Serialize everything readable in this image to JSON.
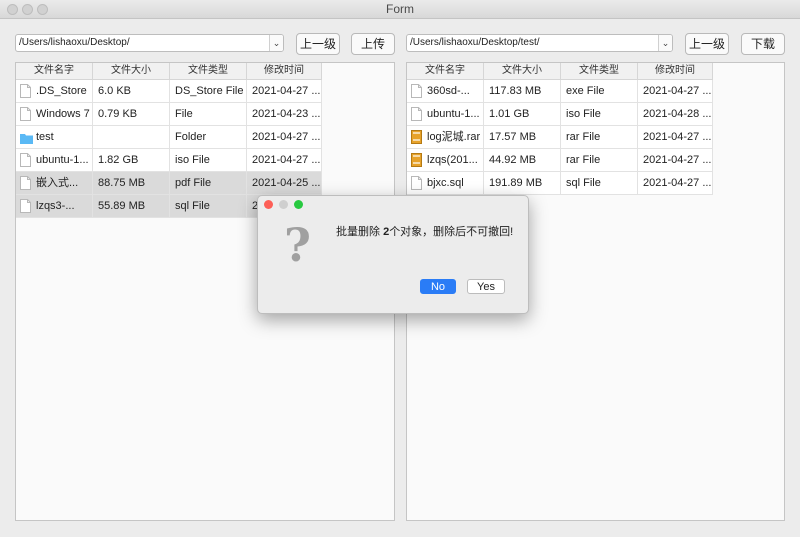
{
  "window": {
    "title": "Form"
  },
  "left": {
    "path": "/Users/lishaoxu/Desktop/",
    "up_button": "上一级",
    "action_button": "上传",
    "columns": [
      "文件名字",
      "文件大小",
      "文件类型",
      "修改时间"
    ],
    "rows": [
      {
        "name": ".DS_Store",
        "size": "6.0  KB",
        "type": "DS_Store File",
        "modified": "2021-04-27 ...",
        "icon": "document-icon",
        "selected": false
      },
      {
        "name": "Windows 7",
        "size": "0.79  KB",
        "type": "File",
        "modified": "2021-04-23 ...",
        "icon": "document-icon",
        "selected": false
      },
      {
        "name": "test",
        "size": "",
        "type": "Folder",
        "modified": "2021-04-27 ...",
        "icon": "folder-icon",
        "selected": false
      },
      {
        "name": "ubuntu-1...",
        "size": "1.82 GB",
        "type": "iso File",
        "modified": "2021-04-27 ...",
        "icon": "document-icon",
        "selected": false
      },
      {
        "name": "嵌入式...",
        "size": "88.75  MB",
        "type": "pdf File",
        "modified": "2021-04-25 ...",
        "icon": "document-icon",
        "selected": true
      },
      {
        "name": "lzqs3-...",
        "size": "55.89  MB",
        "type": "sql File",
        "modified": "20",
        "icon": "document-icon",
        "selected": true
      }
    ]
  },
  "right": {
    "path": "/Users/lishaoxu/Desktop/test/",
    "up_button": "上一级",
    "action_button": "下载",
    "columns": [
      "文件名字",
      "文件大小",
      "文件类型",
      "修改时间"
    ],
    "rows": [
      {
        "name": "360sd-...",
        "size": "117.83  MB",
        "type": "exe File",
        "modified": "2021-04-27 ...",
        "icon": "document-icon",
        "selected": false
      },
      {
        "name": "ubuntu-1...",
        "size": "1.01 GB",
        "type": "iso File",
        "modified": "2021-04-28 ...",
        "icon": "document-icon",
        "selected": false
      },
      {
        "name": "log泥城.rar",
        "size": "17.57  MB",
        "type": "rar File",
        "modified": "2021-04-27 ...",
        "icon": "archive-icon",
        "selected": false
      },
      {
        "name": "lzqs(201...",
        "size": "44.92  MB",
        "type": "rar File",
        "modified": "2021-04-27 ...",
        "icon": "archive-icon",
        "selected": false
      },
      {
        "name": "bjxc.sql",
        "size": "191.89  MB",
        "type": "sql File",
        "modified": "2021-04-27 ...",
        "icon": "document-icon",
        "selected": false
      }
    ]
  },
  "dialog": {
    "message_prefix": "批量删除 ",
    "message_count": "2",
    "message_suffix": "个对象，删除后不可撤回!",
    "no_label": "No",
    "yes_label": "Yes"
  },
  "colors": {
    "accent": "#2a7cf6",
    "close": "#fd5f57",
    "minimize": "#fdbc2e",
    "zoom": "#28c940",
    "folder": "#5bb8f5",
    "archive": "#e7a22a"
  }
}
